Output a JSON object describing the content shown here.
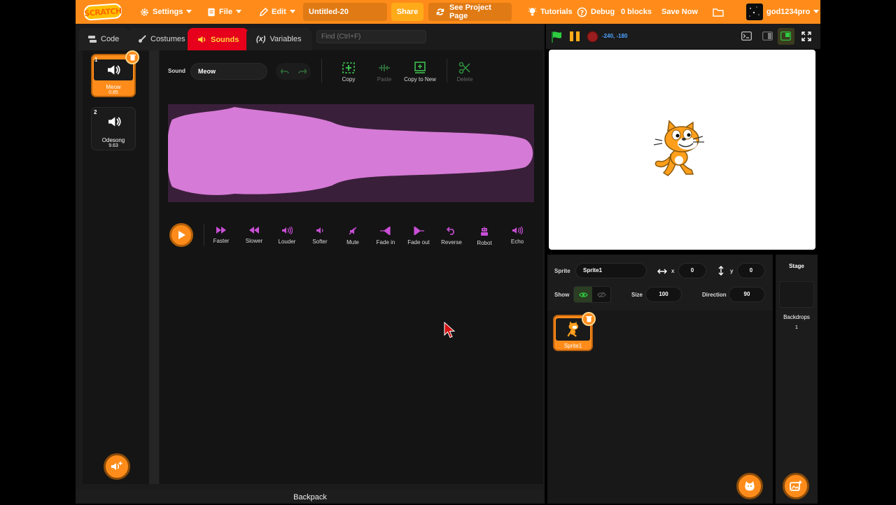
{
  "menubar": {
    "logo": "SCRATCH",
    "settings": "Settings",
    "file": "File",
    "edit": "Edit",
    "project_title": "Untitled-20",
    "share": "Share",
    "see_project_page": "See Project Page",
    "tutorials": "Tutorials",
    "debug": "Debug",
    "blocks_count": "0 blocks",
    "save_now": "Save Now",
    "username": "god1234pro"
  },
  "tabs": {
    "code": "Code",
    "costumes": "Costumes",
    "sounds": "Sounds",
    "variables": "Variables"
  },
  "find": {
    "placeholder": "Find (Ctrl+F)"
  },
  "sounds": [
    {
      "num": "1",
      "name": "Meow",
      "length": "0.85",
      "selected": true
    },
    {
      "num": "2",
      "name": "Odesong",
      "length": "9.63",
      "selected": false
    }
  ],
  "editor": {
    "sound_label": "Sound",
    "sound_name": "Meow",
    "tools": {
      "copy": "Copy",
      "paste": "Paste",
      "copy_to_new": "Copy to New",
      "delete": "Delete"
    },
    "effects": [
      "Faster",
      "Slower",
      "Louder",
      "Softer",
      "Mute",
      "Fade in",
      "Fade out",
      "Reverse",
      "Robot",
      "Echo"
    ]
  },
  "backpack": "Backpack",
  "stage": {
    "coords": "-240, -180"
  },
  "sprite_info": {
    "sprite_label": "Sprite",
    "sprite_name": "Sprite1",
    "x_label": "x",
    "x": "0",
    "y_label": "y",
    "y": "0",
    "show_label": "Show",
    "size_label": "Size",
    "size": "100",
    "direction_label": "Direction",
    "direction": "90"
  },
  "sprites": [
    {
      "name": "Sprite1"
    }
  ],
  "stage_panel": {
    "title": "Stage",
    "backdrops_label": "Backdrops",
    "backdrops_count": "1"
  },
  "colors": {
    "accent": "#ff8c1a",
    "sounds_tab": "#e6001b",
    "waveform": "#d57ad6",
    "effect_icon": "#c94fd6",
    "tool_icon": "#3dbf4f"
  }
}
